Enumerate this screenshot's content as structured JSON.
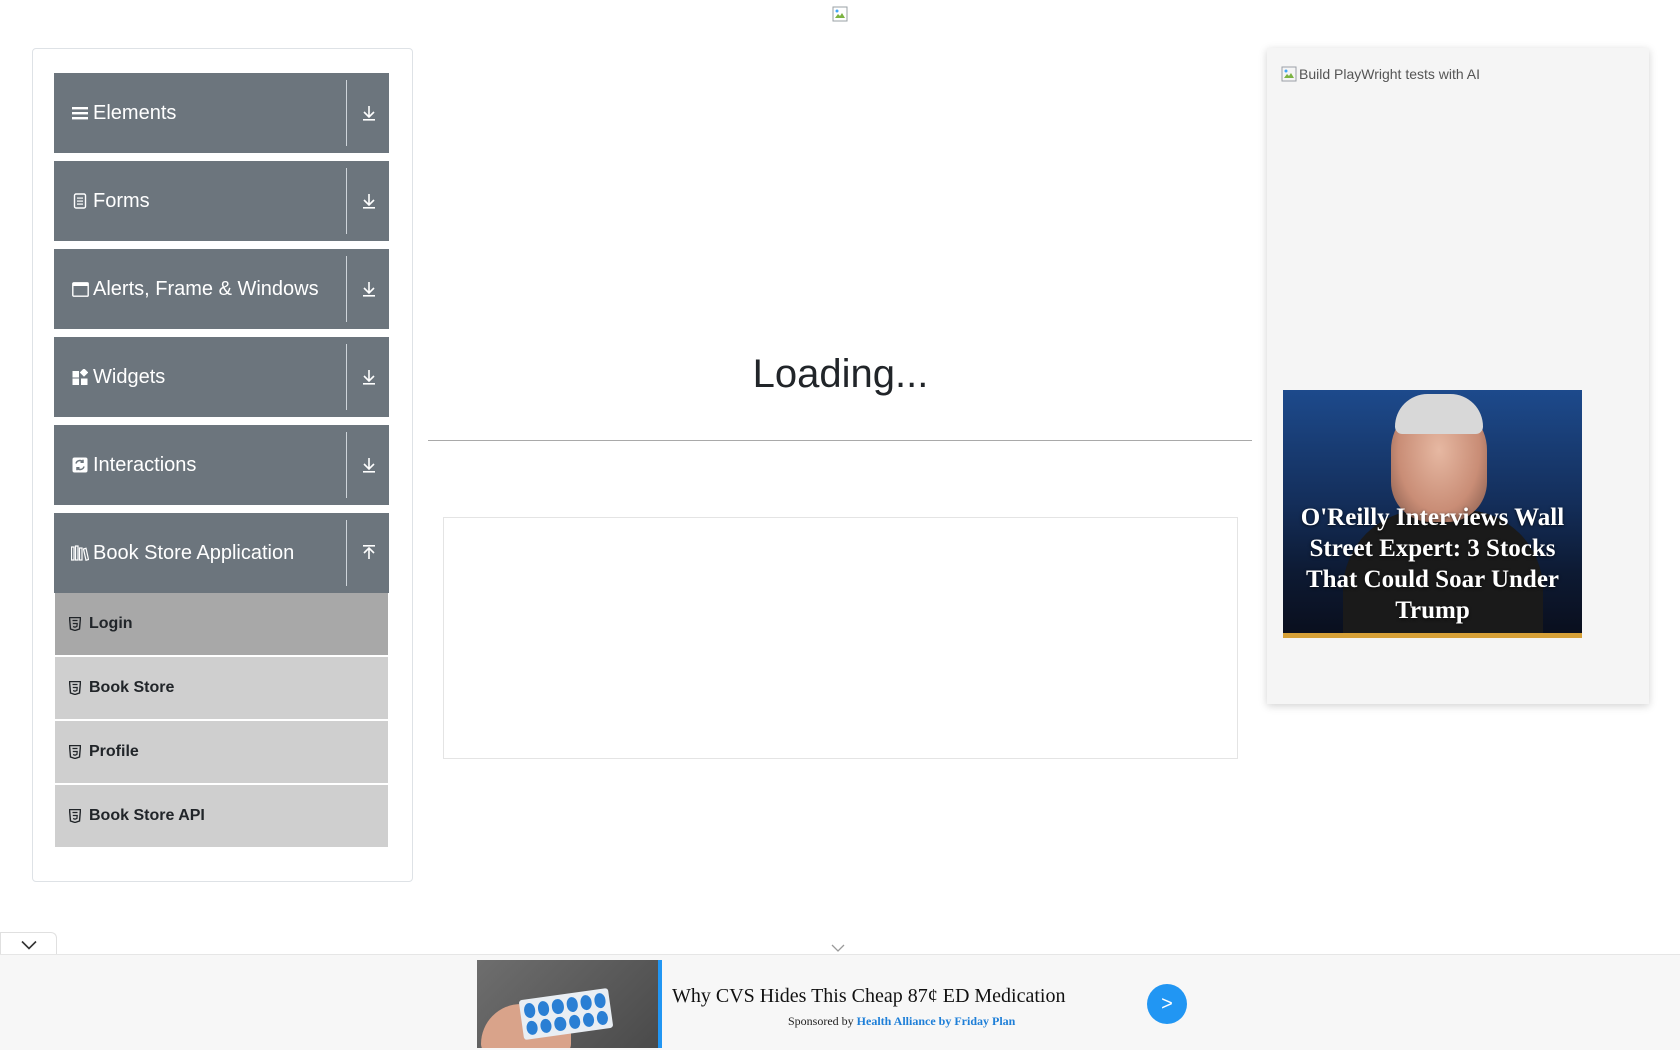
{
  "sidebar": {
    "groups": [
      {
        "label": "Elements",
        "icon": "hamburger-icon",
        "arrow": "download-arrow-icon"
      },
      {
        "label": "Forms",
        "icon": "document-icon",
        "arrow": "download-arrow-icon"
      },
      {
        "label": "Alerts, Frame & Windows",
        "icon": "window-icon",
        "arrow": "download-arrow-icon"
      },
      {
        "label": "Widgets",
        "icon": "widgets-icon",
        "arrow": "download-arrow-icon"
      },
      {
        "label": "Interactions",
        "icon": "interactions-icon",
        "arrow": "download-arrow-icon"
      },
      {
        "label": "Book Store Application",
        "icon": "books-icon",
        "arrow": "upload-arrow-icon"
      }
    ],
    "book_store_items": [
      {
        "label": "Login",
        "active": true
      },
      {
        "label": "Book Store",
        "active": false
      },
      {
        "label": "Profile",
        "active": false
      },
      {
        "label": "Book Store API",
        "active": false
      }
    ]
  },
  "main": {
    "loading_text": "Loading..."
  },
  "right_ad": {
    "image_alt": "Build PlayWright tests with AI",
    "card_title": "O'Reilly Interviews Wall Street Expert: 3 Stocks That Could Soar Under Trump"
  },
  "bottom_ad": {
    "headline": "Why CVS Hides This Cheap 87¢ ED Medication",
    "sponsored_by": "Sponsored by",
    "sponsor_name": "Health Alliance by Friday Plan",
    "go_label": ">"
  },
  "colors": {
    "group_bg": "#6c757d",
    "item_bg": "#cfcfcf",
    "item_active_bg": "#a8a8a8",
    "ad_button": "#2196f3"
  }
}
